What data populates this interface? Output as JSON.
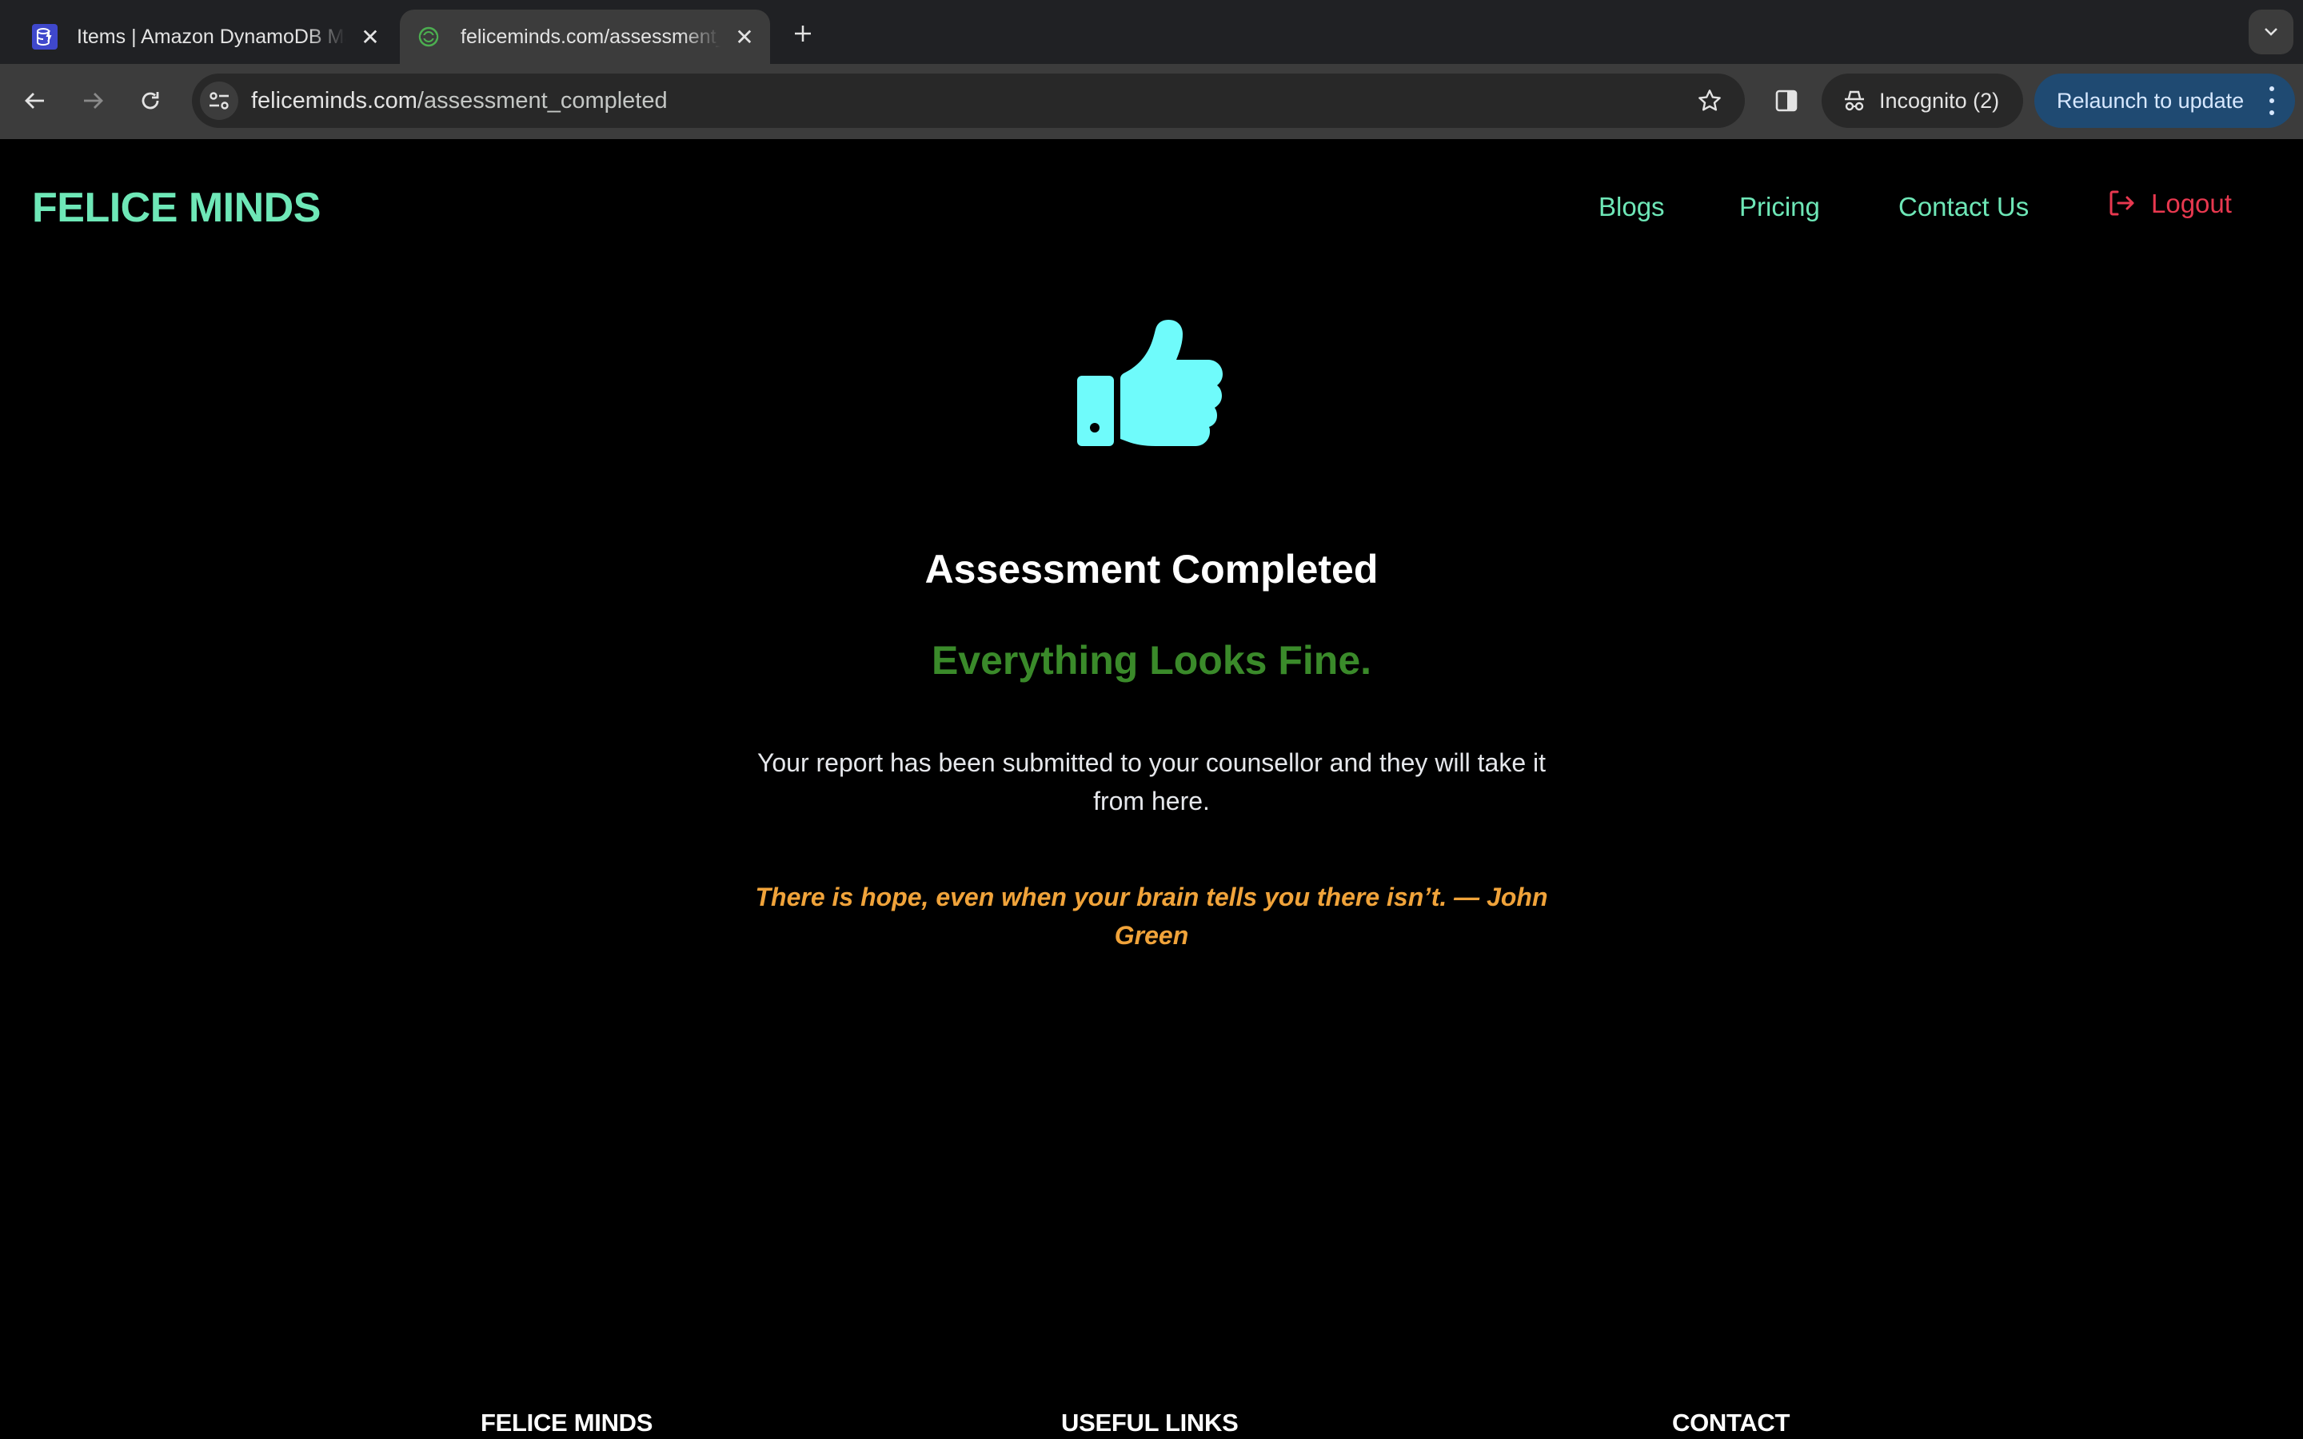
{
  "browser": {
    "tabs": [
      {
        "title": "Items | Amazon DynamoDB Management Console",
        "favicon": "dynamodb-icon",
        "active": false
      },
      {
        "title": "feliceminds.com/assessment_completed",
        "favicon": "feliceminds-icon",
        "active": true
      }
    ],
    "omnibox": {
      "domain": "feliceminds.com",
      "path": "/assessment_completed"
    },
    "incognito_label": "Incognito (2)",
    "relaunch_label": "Relaunch to update"
  },
  "site": {
    "logo": "FELICE MINDS",
    "nav": {
      "links": [
        "Blogs",
        "Pricing",
        "Contact Us"
      ],
      "logout": "Logout"
    }
  },
  "main": {
    "icon": "thumbs-up-icon",
    "title": "Assessment Completed",
    "status": "Everything Looks Fine.",
    "message": "Your report has been submitted to your counsellor and they will take it from here.",
    "quote": "There is hope, even when your brain tells you there isn’t. — John Green"
  },
  "footer": {
    "headings": [
      "FELICE MINDS",
      "USEFUL LINKS",
      "CONTACT"
    ]
  },
  "colors": {
    "brand": "#6ee7b7",
    "logout": "#e8384f",
    "icon": "#6ffbfb",
    "status_ok": "#3a8a2a",
    "quote": "#f0a33a"
  }
}
